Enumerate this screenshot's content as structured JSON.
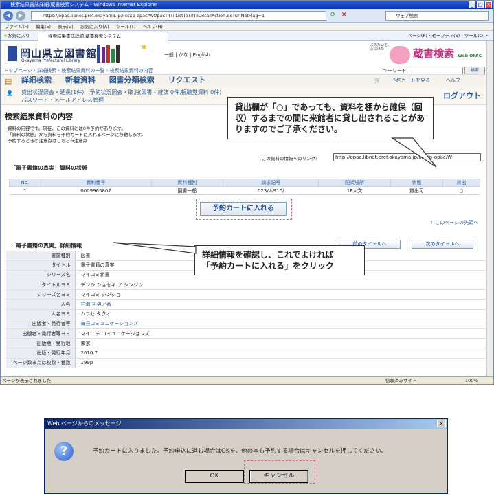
{
  "browser": {
    "window_title": "検索結果書誌詳細:蔵書検索システム - Windows Internet Explorer",
    "url": "https://opac.libnet.pref.okayama.jp/licsxp-opac/WOpacTifTilListToTifTilDetailAction.do?urlNotFlag=1",
    "search_placeholder": "ウェブ検索",
    "menu": [
      "ファイル(F)",
      "編集(E)",
      "表示(V)",
      "お気に入り(A)",
      "ツール(T)",
      "ヘルプ(H)"
    ],
    "favorites_label": "お気に入り",
    "tab_title": "検索結果書誌詳細:蔵書検索システム",
    "right_tools": "ページ(P)・セーフティ(S)・ツール(O)・",
    "status_text": "ページが表示されました",
    "zone": "信頼済みサイト",
    "zoom": "100%"
  },
  "site": {
    "library_name": "岡山県立図書館",
    "library_sub": "Okayama Prefectural Library",
    "lang_links": "一般 | かな | English",
    "brand": "蔵書検索",
    "brand_sub": "Web OPAC",
    "mascot_text": "よみたいを、みつけた"
  },
  "breadcrumb": "トップページ › 詳細検索 › 検索結果資料の一覧 › 検索結果資料の内容",
  "keyword_label": "キーワード",
  "search_button": "検索",
  "nav": {
    "items": [
      "詳細検索",
      "新着資料",
      "図書分類検索",
      "リクエスト"
    ],
    "cart": "予約カートを見る",
    "help": "ヘルプ"
  },
  "user": {
    "line1": "貸出状況照会・延長(1件)　予約状況照会・取消(図書・雑誌 0件,視聴覚資料 0件)",
    "line2": "パスワード・メールアドレス管理",
    "logout": "ログアウト"
  },
  "page_title": "検索結果資料の内容",
  "intro": [
    "資料の内容です。現在、この資料には0件予約があります。",
    "「資料の状態」から資料を予約カートに入れるページに移動します。",
    "予約するときの注意点はこちら→注意点"
  ],
  "link_label": "この資料の情報へのリンク:",
  "link_value": "http://opac.libnet.pref.okayama.jp/licsxp-opac/W",
  "holdings": {
    "title": "「電子書籍の真実」資料の状態",
    "headers": [
      "No.",
      "資料番号",
      "資料種別",
      "請求記号",
      "配架場所",
      "状態",
      "貸出"
    ],
    "row": [
      "1",
      "0009965807",
      "図書一般",
      "023/ム910/",
      "1F人文",
      "貸出可",
      "○"
    ]
  },
  "cart_button": "予約カートに入れる",
  "page_top": "このページの先頭へ",
  "detail": {
    "title": "「電子書籍の真実」詳細情報",
    "prev": "前のタイトルへ",
    "next": "次のタイトルへ",
    "rows": [
      [
        "書誌種別",
        "図書"
      ],
      [
        "タイトル",
        "電子書籍の真実"
      ],
      [
        "シリーズ名",
        "マイコミ新書"
      ],
      [
        "タイトルヨミ",
        "デンシ ショセキ ノ シンジツ"
      ],
      [
        "シリーズ名ヨミ",
        "マイコミ シンショ"
      ],
      [
        "人名",
        "村瀬 拓男／著"
      ],
      [
        "人名ヨミ",
        "ムラセ タクオ"
      ],
      [
        "出版者・発行者等",
        "毎日コミュニケーションズ"
      ],
      [
        "出版者・発行者等ヨミ",
        "マイニチ コミュニケーションズ"
      ],
      [
        "出版地・発行地",
        "東京"
      ],
      [
        "出版・発行年月",
        "2010.7"
      ],
      [
        "ページ数または枚数・巻数",
        "199p"
      ]
    ]
  },
  "callouts": {
    "top": "貸出欄が「○」であっても、資料を棚から確保（回収）するまでの間に来館者に貸し出されることがありますのでご了承ください。",
    "middle_1": "詳細情報を確認し、これでよければ",
    "middle_2": "「予約カートに入れる」をクリック"
  },
  "dialog": {
    "title": "Web ページからのメッセージ",
    "message": "予約カートに入りました。予約申込に進む場合はOKを、他の本も予約する場合はキャンセルを押してください。",
    "ok": "OK",
    "cancel": "キャンセル"
  }
}
